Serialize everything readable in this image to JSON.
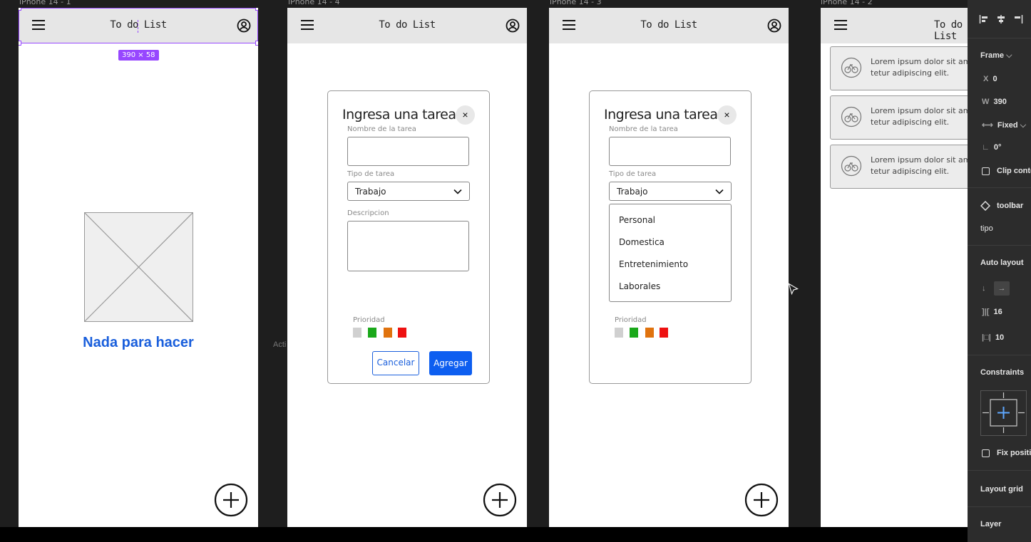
{
  "frames": [
    {
      "label": "iPhone 14 - 1"
    },
    {
      "label": "iPhone 14 - 4"
    },
    {
      "label": "iPhone 14 - 3"
    },
    {
      "label": "iPhone 14 - 2"
    }
  ],
  "appbar": {
    "title": "To do List"
  },
  "selection": {
    "size_badge": "390 × 58"
  },
  "empty_state": {
    "text": "Nada para hacer"
  },
  "modal": {
    "title": "Ingresa una tarea",
    "close": "×",
    "name_label": "Nombre de la tarea",
    "type_label": "Tipo de tarea",
    "type_value": "Trabajo",
    "description_label": "Descripcion",
    "priority_label": "Prioridad",
    "priority_colors": [
      "#d0d0d0",
      "#1aa81a",
      "#e0730e",
      "#ee1111"
    ],
    "cancel_label": "Cancelar",
    "add_label": "Agregar",
    "type_options": [
      "Personal",
      "Domestica",
      "Entretenimiento",
      "Laborales"
    ]
  },
  "task_cards": [
    {
      "line1": "Lorem ipsum dolor sit ame",
      "line2": "tetur adipiscing elit."
    },
    {
      "line1": "Lorem ipsum dolor sit ame",
      "line2": "tetur adipiscing elit."
    },
    {
      "line1": "Lorem ipsum dolor sit ame",
      "line2": "tetur adipiscing elit."
    }
  ],
  "canvas_side_label": "Acti",
  "properties": {
    "frame_label": "Frame",
    "x_label": "X",
    "x_value": "0",
    "w_label": "W",
    "w_value": "390",
    "fixed_label": "Fixed",
    "rotation_value": "0°",
    "clip_label": "Clip conte",
    "component_name": "toolbar",
    "variant": "tipo",
    "auto_layout": "Auto layout",
    "spacing_value": "16",
    "padding_value": "10",
    "constraints": "Constraints",
    "fix_position": "Fix positi",
    "layout_grid": "Layout grid",
    "layer": "Layer"
  },
  "colors": {
    "accent": "#1a5fdc",
    "selection": "#9747ff",
    "primary_button": "#0d5ef0"
  }
}
